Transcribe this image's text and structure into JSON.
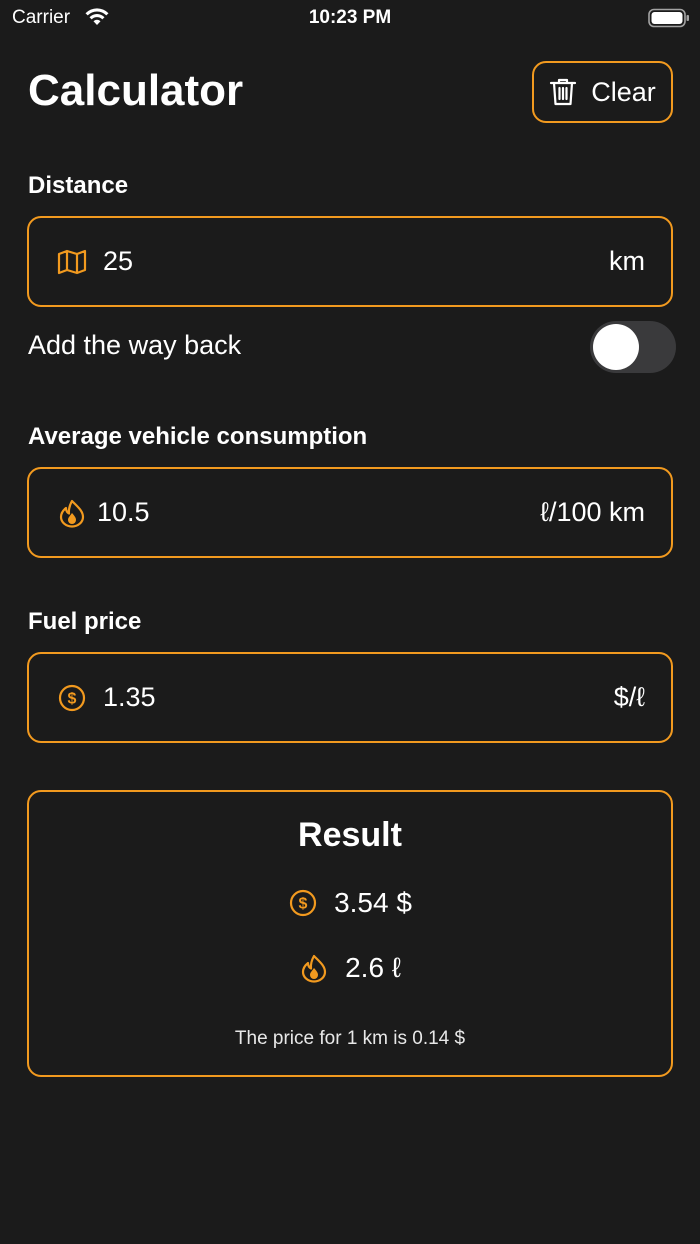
{
  "status": {
    "carrier": "Carrier",
    "time": "10:23 PM"
  },
  "header": {
    "title": "Calculator",
    "clear_label": "Clear"
  },
  "distance": {
    "label": "Distance",
    "value": "25",
    "unit": "km"
  },
  "way_back": {
    "label": "Add the way back",
    "enabled": false
  },
  "consumption": {
    "label": "Average vehicle consumption",
    "value": "10.5",
    "unit": "ℓ/100 km"
  },
  "fuel_price": {
    "label": "Fuel price",
    "value": "1.35",
    "unit": "$/ℓ"
  },
  "result": {
    "title": "Result",
    "cost": "3.54 $",
    "fuel": "2.6 ℓ",
    "note": "The price for 1 km is 0.14 $"
  },
  "colors": {
    "accent": "#f29a1f",
    "background": "#1b1b1b",
    "toggle_off": "#3a3a3c"
  },
  "icons": {
    "clear": "trash-icon",
    "distance": "map-icon",
    "consumption": "flame-icon",
    "price": "dollar-circle-icon"
  }
}
